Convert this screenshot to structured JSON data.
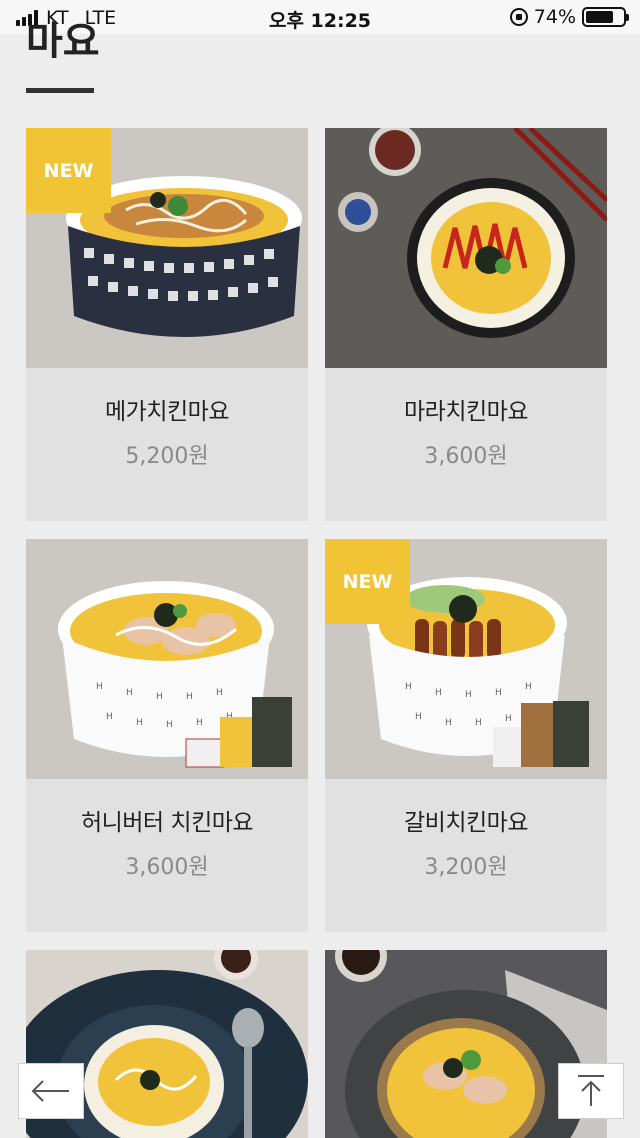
{
  "status_bar": {
    "carrier": "KT",
    "network": "LTE",
    "time": "오후 12:25",
    "battery": "74%",
    "battery_level": 0.74
  },
  "section": {
    "title": "마요"
  },
  "products": [
    {
      "name": "메가치킨마요",
      "price": "5,200원",
      "badge": "NEW"
    },
    {
      "name": "마라치킨마요",
      "price": "3,600원",
      "badge": ""
    },
    {
      "name": "허니버터 치킨마요",
      "price": "3,600원",
      "badge": ""
    },
    {
      "name": "갈비치킨마요",
      "price": "3,200원",
      "badge": "NEW"
    }
  ],
  "icons": {
    "back": "arrow-left-icon",
    "top": "scroll-top-icon"
  }
}
